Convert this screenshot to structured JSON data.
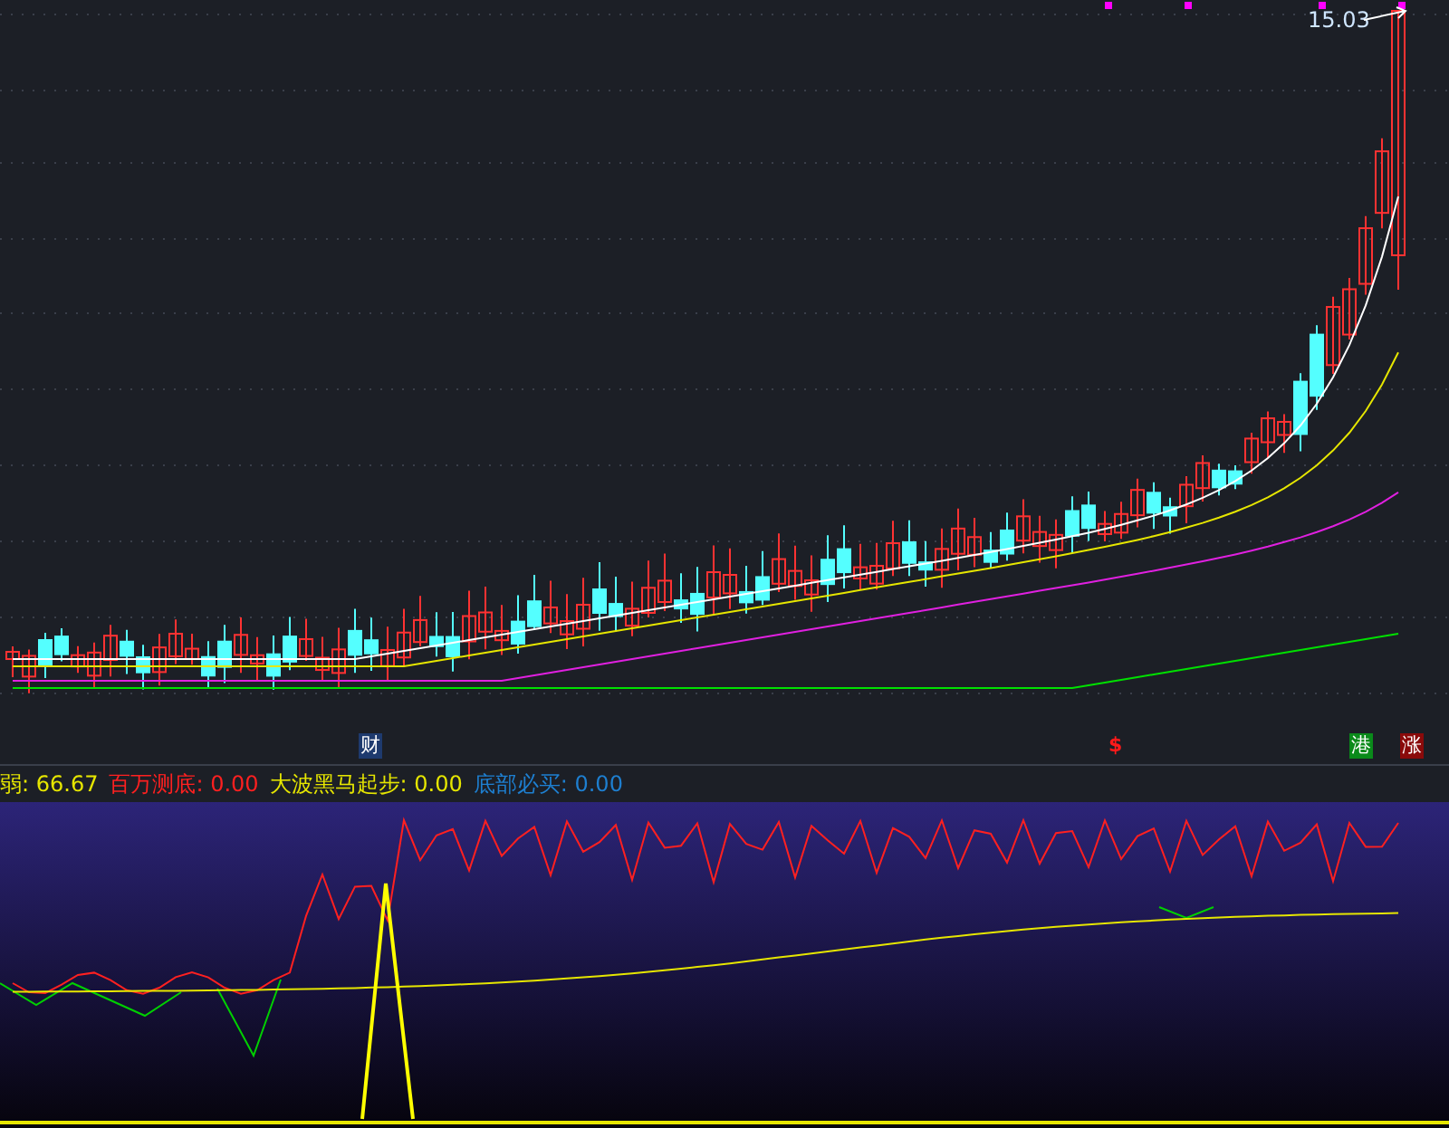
{
  "price_chart": {
    "high_label": "15.03",
    "markers": [
      {
        "text": "财",
        "kind": "badge",
        "color": "#1e3a6e"
      },
      {
        "text": "$",
        "kind": "glyph",
        "color": "#ff1a1a"
      },
      {
        "text": "港",
        "kind": "badge",
        "color": "#0a8a1a"
      },
      {
        "text": "涨",
        "kind": "badge",
        "color": "#8a0a0a"
      }
    ]
  },
  "indicator": {
    "legend": [
      {
        "label": "弱:",
        "value": "66.67",
        "color": "#e6e600"
      },
      {
        "label": "百万测底:",
        "value": "0.00",
        "color": "#ff2020"
      },
      {
        "label": "大波黑马起步:",
        "value": "0.00",
        "color": "#e6e600"
      },
      {
        "label": "底部必买:",
        "value": "0.00",
        "color": "#1e7fd0"
      }
    ]
  }
}
